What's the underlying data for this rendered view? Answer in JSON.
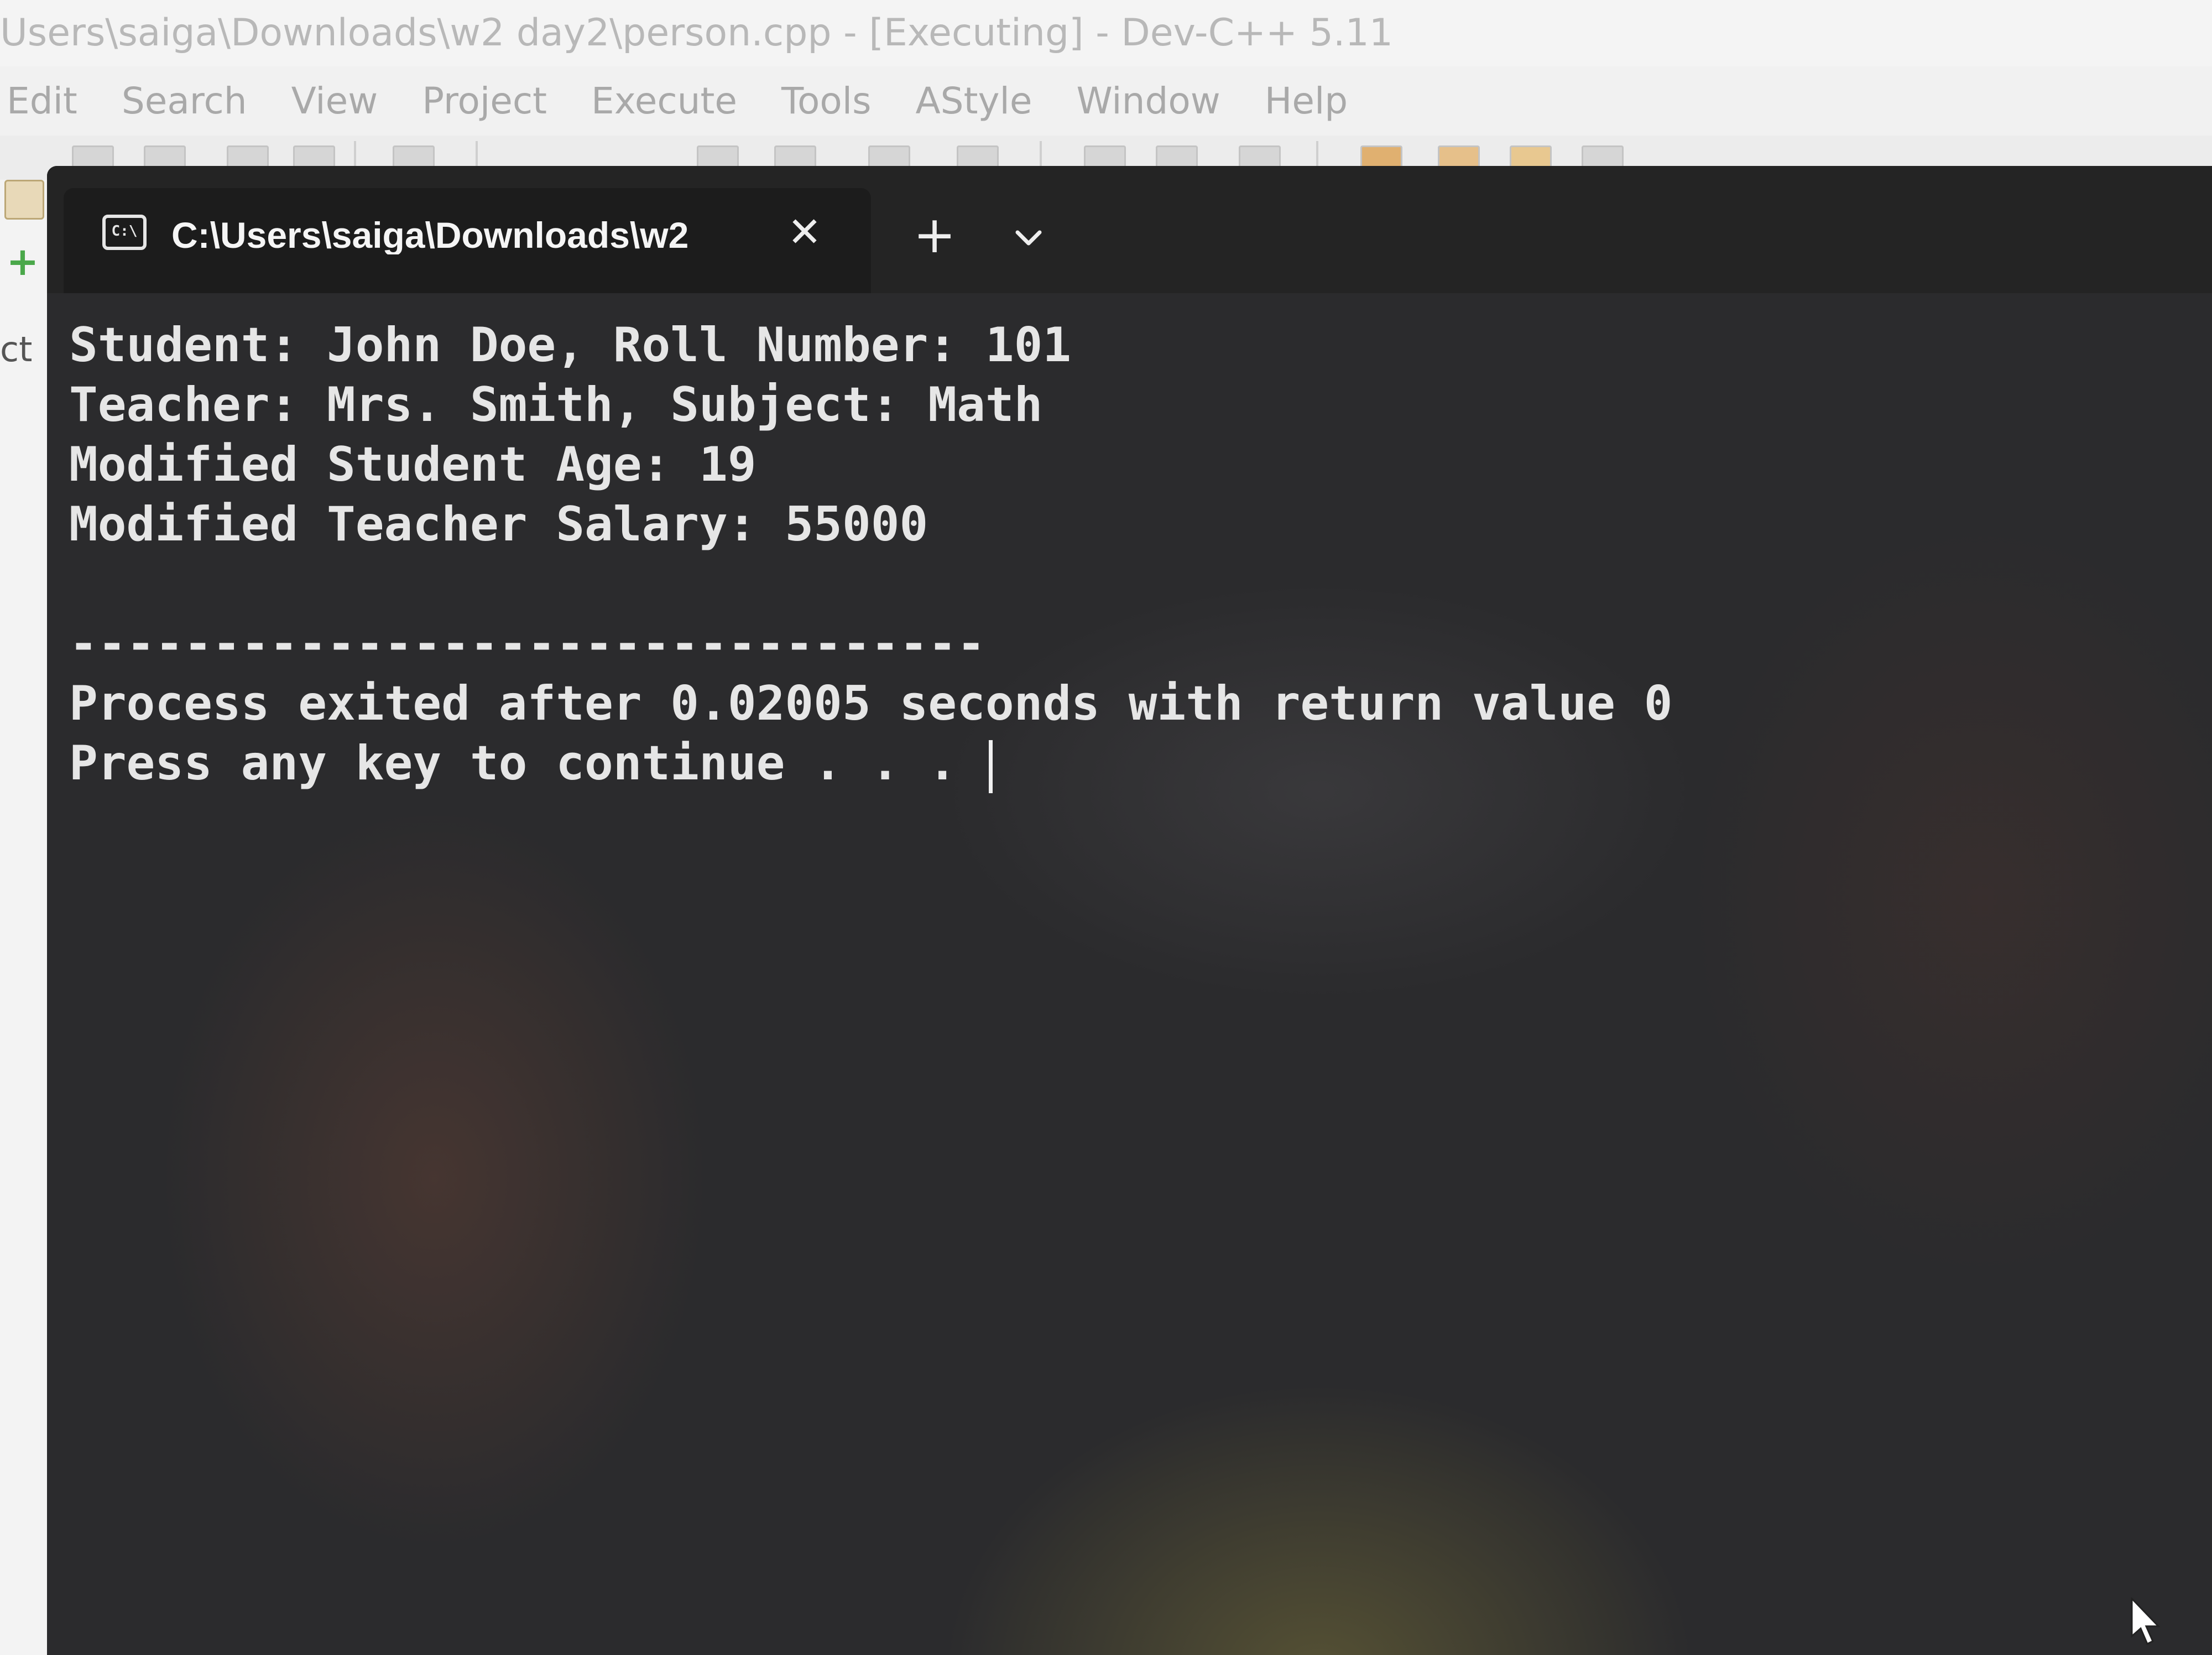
{
  "ide": {
    "title": "Users\\saiga\\Downloads\\w2 day2\\person.cpp - [Executing] - Dev-C++ 5.11",
    "menu": [
      "Edit",
      "Search",
      "View",
      "Project",
      "Execute",
      "Tools",
      "AStyle",
      "Window",
      "Help"
    ],
    "side_label": "ct"
  },
  "terminal": {
    "tab_icon_text": "C:\\",
    "tab_title": "C:\\Users\\saiga\\Downloads\\w2",
    "close_glyph": "✕",
    "new_tab_glyph": "+",
    "output_lines": [
      "Student: John Doe, Roll Number: 101",
      "Teacher: Mrs. Smith, Subject: Math",
      "Modified Student Age: 19",
      "Modified Teacher Salary: 55000",
      "",
      "--------------------------------",
      "Process exited after 0.02005 seconds with return value 0",
      "Press any key to continue . . . "
    ]
  },
  "icons": {
    "tab_icon": "terminal-icon",
    "close": "close-icon",
    "new_tab": "plus-icon",
    "dropdown": "chevron-down-icon",
    "pointer": "mouse-pointer-icon"
  },
  "colors": {
    "terminal_bg": "#1a1a1a",
    "console_text": "#e6e6e6",
    "ide_menu_text": "#a9a9a9"
  }
}
